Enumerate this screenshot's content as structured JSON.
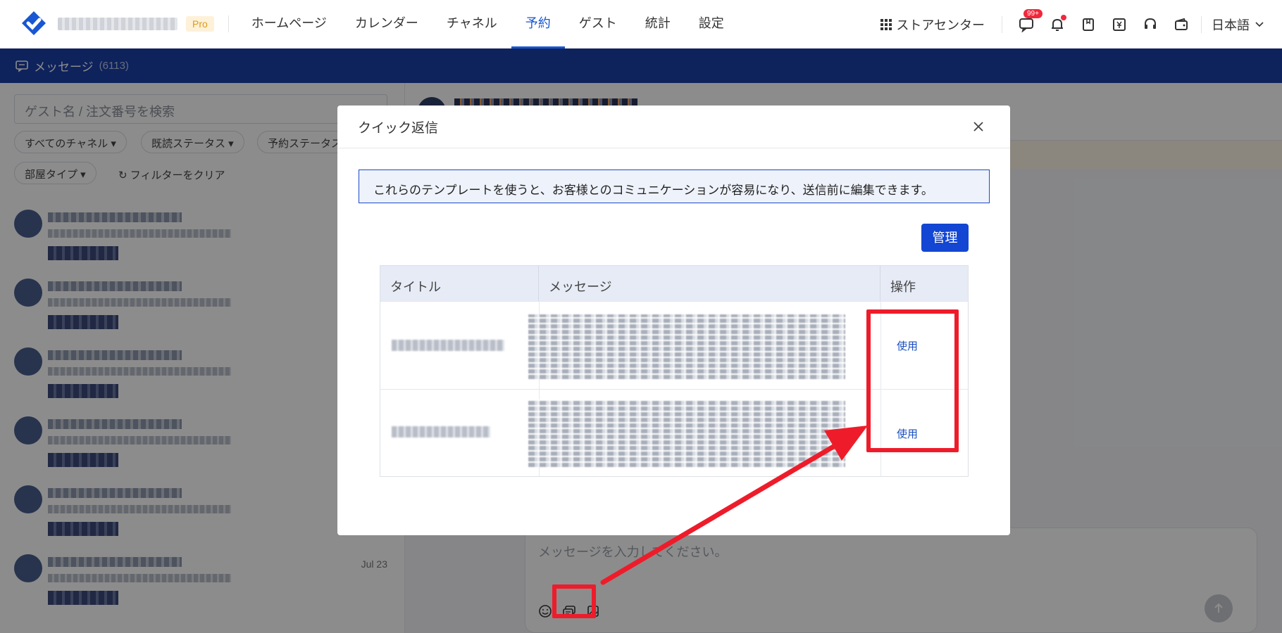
{
  "topbar": {
    "pro_badge": "Pro",
    "nav": [
      "ホームページ",
      "カレンダー",
      "チャネル",
      "予約",
      "ゲスト",
      "統計",
      "設定"
    ],
    "active_index": 3,
    "store_center": "ストアセンター",
    "message_badge": "99+",
    "language": "日本語"
  },
  "messages_bar": {
    "title": "メッセージ",
    "count": "(6113)"
  },
  "left": {
    "search_placeholder": "ゲスト名 / 注文番号を検索",
    "filters": [
      "すべてのチャネル",
      "既読ステータス",
      "予約ステータス",
      "部屋タイプ"
    ],
    "clear_filters": "フィルターをクリア",
    "last_date": "Jul 23"
  },
  "composer": {
    "placeholder": "メッセージを入力してください。"
  },
  "modal": {
    "title": "クイック返信",
    "info": "これらのテンプレートを使うと、お客様とのコミュニケーションが容易になり、送信前に編集できます。",
    "manage_button": "管理",
    "columns": [
      "タイトル",
      "メッセージ",
      "操作"
    ],
    "rows": [
      {
        "action": "使用"
      },
      {
        "action": "使用"
      }
    ]
  },
  "colors": {
    "brand": "#1856d3",
    "highlight": "#ee1c2a",
    "bar": "#1b3fa8"
  }
}
